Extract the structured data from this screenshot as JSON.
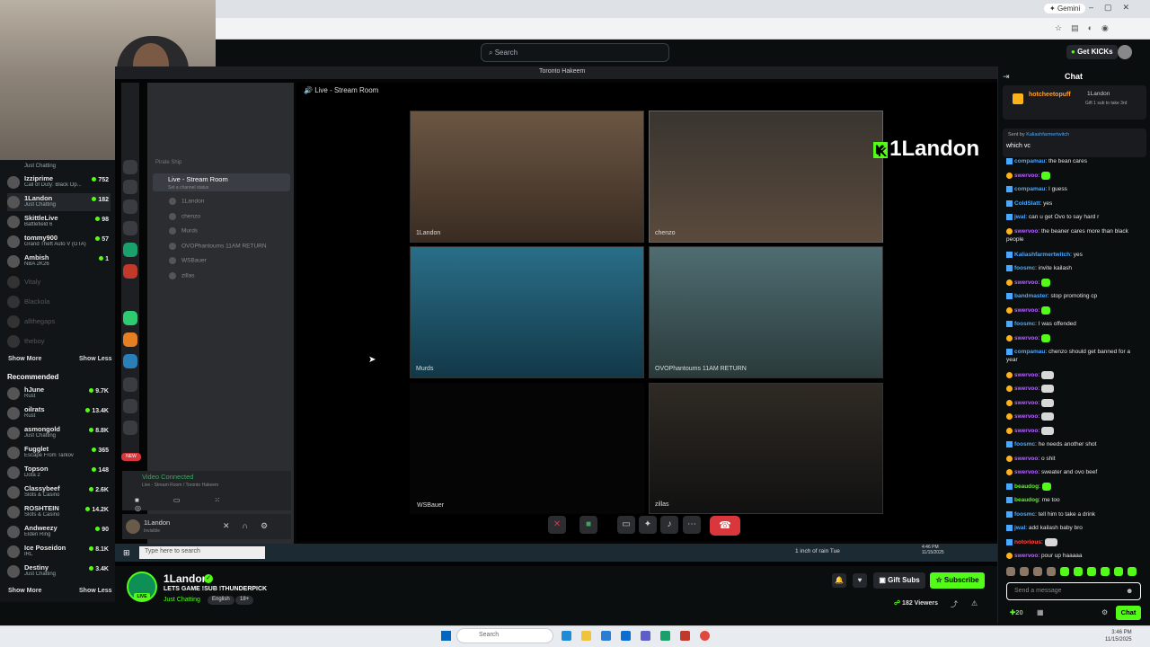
{
  "browser": {
    "gemini_label": "Gemini"
  },
  "site": {
    "search_placeholder": "Search",
    "get_kicks": "Get KICKs"
  },
  "sidebar": {
    "channels": [
      {
        "name": "Izziprime",
        "game": "Call of Duty: Black Op...",
        "viewers": "752"
      },
      {
        "name": "1Landon",
        "game": "Just Chatting",
        "viewers": "182"
      },
      {
        "name": "SkittleLive",
        "game": "Battlefield 6",
        "viewers": "98"
      },
      {
        "name": "tommy900",
        "game": "Grand Theft Auto V (GTA)",
        "viewers": "57"
      },
      {
        "name": "Ambish",
        "game": "NBA 2K26",
        "viewers": "1"
      }
    ],
    "top_category": "Just Chatting",
    "offline": [
      "Vitaly",
      "Blackola",
      "allthegaps",
      "theboy"
    ],
    "show_more": "Show More",
    "show_less": "Show Less",
    "recommended_title": "Recommended",
    "recommended": [
      {
        "name": "hJune",
        "game": "Rust",
        "viewers": "9.7K"
      },
      {
        "name": "oilrats",
        "game": "Rust",
        "viewers": "13.4K"
      },
      {
        "name": "asmongold",
        "game": "Just Chatting",
        "viewers": "8.8K"
      },
      {
        "name": "Fugglet",
        "game": "Escape From Tarkov",
        "viewers": "365"
      },
      {
        "name": "Topson",
        "game": "Dota 2",
        "viewers": "148"
      },
      {
        "name": "Classybeef",
        "game": "Slots & Casino",
        "viewers": "2.6K"
      },
      {
        "name": "ROSHTEIN",
        "game": "Slots & Casino",
        "viewers": "14.2K"
      },
      {
        "name": "Andweezy",
        "game": "Elden Ring",
        "viewers": "90"
      },
      {
        "name": "Ice Poseidon",
        "game": "IRL",
        "viewers": "8.1K"
      },
      {
        "name": "Destiny",
        "game": "Just Chatting",
        "viewers": "3.4K"
      }
    ]
  },
  "discord": {
    "window_title": "Toronto Hakeem",
    "stage_title": "Live - Stream Room",
    "server_name": "Pirate Ship",
    "room_name": "Live - Stream Room",
    "room_status": "Set a channel status",
    "voice_users": [
      "1Landon",
      "chenzo",
      "Murds",
      "OVOPhantoums 11AM RETURN",
      "WSBauer",
      "zillas"
    ],
    "new_badge": "NEW",
    "tiles": [
      "1Landon",
      "chenzo",
      "Murds",
      "OVOPhantoums 11AM RETURN",
      "WSBauer",
      "zillas"
    ],
    "vc_connected": "Video Connected",
    "vc_sub": "Live - Stream Room / Toronto Hakeem",
    "user_name": "1Landon",
    "user_status": "Invisible",
    "taskbar_search": "Type here to search",
    "weather": "1 inch of rain Tue",
    "time": "4:46 PM",
    "date": "11/15/2025"
  },
  "overlay_name": "1Landon",
  "chat": {
    "title": "Chat",
    "pinned_user": "hotcheetopuff",
    "pinned_target": "1Landon",
    "pinned_note": "Gift 1 sub to take 3rd",
    "sent_by_label": "Sent by",
    "sent_by_user": "Kaliashfarmertwitch",
    "sent_msg": "which vc",
    "messages": [
      {
        "user": "compamau",
        "text": "the bean cares",
        "color": "#4aa8ff"
      },
      {
        "user": "swervoo",
        "text": "",
        "color": "#b565ff",
        "emote": "green"
      },
      {
        "user": "compamau",
        "text": "I guess",
        "color": "#4aa8ff"
      },
      {
        "user": "ColdSlatt",
        "text": "yes",
        "color": "#4aa8ff"
      },
      {
        "user": "jwal",
        "text": "can u get Ovo to say hard r",
        "color": "#4aa8ff"
      },
      {
        "user": "swervoo",
        "text": "the beaner cares more than black people",
        "color": "#b565ff"
      },
      {
        "user": "Kaliashfarmertwitch",
        "text": "yes",
        "color": "#4aa8ff"
      },
      {
        "user": "foosmc",
        "text": "invite kailash",
        "color": "#4aa8ff"
      },
      {
        "user": "swervoo",
        "text": "",
        "color": "#b565ff",
        "emote": "green"
      },
      {
        "user": "bandmaster",
        "text": "stop promoting cp",
        "color": "#4aa8ff"
      },
      {
        "user": "swervoo",
        "text": "",
        "color": "#b565ff",
        "emote": "green"
      },
      {
        "user": "foosmc",
        "text": "I was offended",
        "color": "#4aa8ff"
      },
      {
        "user": "swervoo",
        "text": "",
        "color": "#b565ff",
        "emote": "green"
      },
      {
        "user": "compamau",
        "text": "chenzo should get banned for a year",
        "color": "#4aa8ff"
      },
      {
        "user": "swervoo",
        "text": "",
        "color": "#b565ff",
        "emote": "grey"
      },
      {
        "user": "swervoo",
        "text": "",
        "color": "#b565ff",
        "emote": "grey"
      },
      {
        "user": "swervoo",
        "text": "",
        "color": "#b565ff",
        "emote": "grey"
      },
      {
        "user": "swervoo",
        "text": "",
        "color": "#b565ff",
        "emote": "grey"
      },
      {
        "user": "swervoo",
        "text": "",
        "color": "#b565ff",
        "emote": "grey"
      },
      {
        "user": "foosmc",
        "text": "he needs another shot",
        "color": "#4aa8ff"
      },
      {
        "user": "swervoo",
        "text": "o shit",
        "color": "#b565ff"
      },
      {
        "user": "swervoo",
        "text": "sweater and ovo beef",
        "color": "#b565ff"
      },
      {
        "user": "beaudog",
        "text": "",
        "color": "#53fc18",
        "emote": "green"
      },
      {
        "user": "beaudog",
        "text": "me too",
        "color": "#53fc18"
      },
      {
        "user": "foosmc",
        "text": "tell him to take a drink",
        "color": "#4aa8ff"
      },
      {
        "user": "jwal",
        "text": "add kailash baby bro",
        "color": "#4aa8ff"
      },
      {
        "user": "notorious",
        "text": "",
        "color": "#ff4a4a",
        "emote": "grey"
      },
      {
        "user": "swervoo",
        "text": "pour up haaaaa",
        "color": "#b565ff"
      }
    ],
    "input_placeholder": "Send a message",
    "points": "20",
    "chat_button": "Chat"
  },
  "streamer": {
    "name": "1Landon",
    "title": "LETS GAME !SUB !THUNDERPICK",
    "category": "Just Chatting",
    "tags": [
      "English",
      "18+"
    ],
    "gift_subs": "Gift Subs",
    "subscribe": "Subscribe",
    "viewers": "182 Viewers",
    "live_badge": "LIVE"
  },
  "windows": {
    "search": "Search",
    "time": "3:46 PM",
    "date": "11/15/2025"
  },
  "colors": {
    "kick_green": "#53fc18",
    "hangup_red": "#da373c",
    "discord_green": "#3ba55c"
  }
}
